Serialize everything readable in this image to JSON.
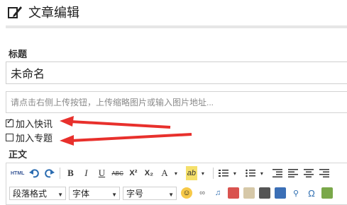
{
  "header": {
    "title": "文章编辑",
    "icon": "edit-icon"
  },
  "form": {
    "title_label": "标题",
    "title_value": "未命名",
    "thumbnail_placeholder": "请点击右侧上传按钮，上传缩略图片或输入图片地址...",
    "options": [
      {
        "label": "加入快讯",
        "checked": true
      },
      {
        "label": "加入专题",
        "checked": false
      }
    ],
    "body_label": "正文"
  },
  "editor": {
    "toolbar": {
      "html_label": "HTML",
      "bold": "B",
      "italic": "I",
      "underline": "U",
      "strike": "ABC",
      "superscript": "X²",
      "subscript": "X₂",
      "font_color": "A",
      "highlight": "ab"
    },
    "dropdowns": {
      "paragraph": "段落格式",
      "font": "字体",
      "font_size": "字号"
    }
  },
  "colors": {
    "arrow": "#e8302c",
    "divider": "#e6e6e6"
  }
}
